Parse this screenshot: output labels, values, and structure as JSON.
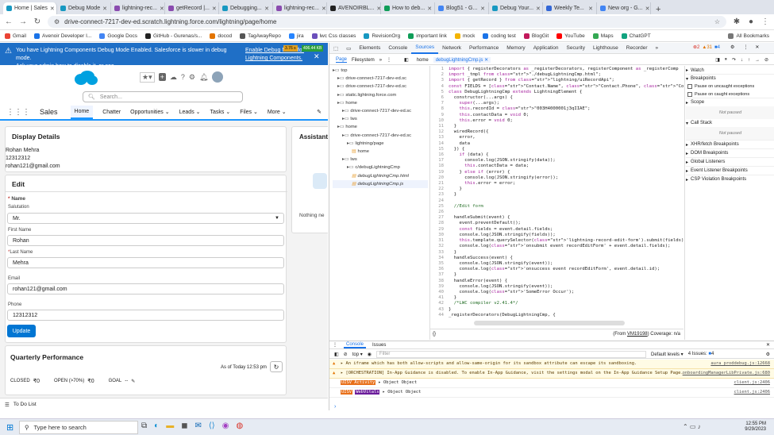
{
  "browser": {
    "tabs": [
      {
        "title": "Home | Sales",
        "active": true,
        "color": "#1798c1"
      },
      {
        "title": "Debug Mode",
        "active": false,
        "color": "#1798c1"
      },
      {
        "title": "lightning-rec...",
        "active": false,
        "color": "#8a4baf"
      },
      {
        "title": "getRecord |...",
        "active": false,
        "color": "#8a4baf"
      },
      {
        "title": "Debugging...",
        "active": false,
        "color": "#1798c1"
      },
      {
        "title": "lightning-rec...",
        "active": false,
        "color": "#8a4baf"
      },
      {
        "title": "AVENOIRBL...",
        "active": false,
        "color": "#222222"
      },
      {
        "title": "How to deb...",
        "active": false,
        "color": "#0f9d58"
      },
      {
        "title": "Blog51 - G...",
        "active": false,
        "color": "#4285f4"
      },
      {
        "title": "Debug Your...",
        "active": false,
        "color": "#1798c1"
      },
      {
        "title": "Weekly Te...",
        "active": false,
        "color": "#3367d6"
      },
      {
        "title": "New org - G...",
        "active": false,
        "color": "#4285f4"
      }
    ],
    "url": "drive-connect-7217-dev-ed.scratch.lightning.force.com/lightning/page/home",
    "bookmarks": [
      "Gmail",
      "Avenoir Developer I...",
      "Google Docs",
      "GitHub - Gurenas/s...",
      "docod",
      "TagAwayRepo",
      "jira",
      "lwc Css classes",
      "RevisionOrg",
      "important link",
      "mock",
      "coding test",
      "BlogGit",
      "YouTube",
      "Maps",
      "ChatGPT"
    ],
    "all_bookmarks": "All Bookmarks"
  },
  "sf": {
    "banner_text_1": "You have Lightning Components Debug Mode Enabled. Salesforce is slower in debug mode.",
    "banner_text_2": "Ask your admin how to disable it, or see",
    "banner_link_1": "Enable Debug Mode for",
    "banner_link_2": "Lightning Components.",
    "debug_badge": "3.76 s",
    "debug_badge2": "406.44 KB",
    "search_placeholder": "Search...",
    "app_name": "Sales",
    "nav": [
      "Home",
      "Chatter",
      "Opportunities",
      "Leads",
      "Tasks",
      "Files",
      "More"
    ],
    "display": {
      "title": "Display Details",
      "name": "Rohan Mehra",
      "phone": "12312312",
      "email": "rohan121@gmail.com"
    },
    "edit": {
      "title": "Edit",
      "name_label": "Name",
      "salutation_label": "Salutation",
      "salutation_value": "Mr.",
      "first_label": "First Name",
      "first_value": "Rohan",
      "last_label": "Last Name",
      "last_value": "Mehra",
      "email_label": "Email",
      "email_value": "rohan121@gmail.com",
      "phone_label": "Phone",
      "phone_value": "12312312",
      "update": "Update"
    },
    "assistant": {
      "title": "Assistant",
      "empty": "Nothing ne"
    },
    "qp": {
      "title": "Quarterly Performance",
      "asof": "As of Today 12:53 pm",
      "closed": "CLOSED",
      "closed_val": "₹0",
      "open": "OPEN (>70%)",
      "open_val": "₹0",
      "goal": "GOAL",
      "goal_val": "--"
    },
    "todo": "To Do List"
  },
  "devtools": {
    "tabs": [
      "Elements",
      "Console",
      "Sources",
      "Network",
      "Performance",
      "Memory",
      "Application",
      "Security",
      "Lighthouse",
      "Recorder"
    ],
    "errors": "2",
    "warnings": "31",
    "infos": "4",
    "sub_tabs": [
      "Page",
      "Filesystem"
    ],
    "file_tabs": [
      "home",
      "debugLightningCmp.js"
    ],
    "tree": [
      {
        "label": "top",
        "depth": 0
      },
      {
        "label": "drive-connect-7217-dev-ed.sc",
        "depth": 1
      },
      {
        "label": "drive-connect-7217-dev-ed.sc",
        "depth": 1
      },
      {
        "label": "static.lightning.force.com",
        "depth": 1
      },
      {
        "label": "home",
        "depth": 1
      },
      {
        "label": "drive-connect-7217-dev-ed.sc",
        "depth": 2
      },
      {
        "label": "lws",
        "depth": 2
      },
      {
        "label": "home",
        "depth": 1
      },
      {
        "label": "drive-connect-7217-dev-ed.sc",
        "depth": 2
      },
      {
        "label": "lightning/page",
        "depth": 3
      },
      {
        "label": "home",
        "depth": 4
      },
      {
        "label": "lws",
        "depth": 2
      },
      {
        "label": "c/debugLightningCmp",
        "depth": 3
      },
      {
        "label": "debugLightningCmp.html",
        "depth": 4
      },
      {
        "label": "debugLightningCmp.js",
        "depth": 4
      }
    ],
    "code": [
      "import { registerDecorators as _registerDecorators, registerComponent as _registerComp",
      "import _tmpl from \"./debugLightningCmp.html\";",
      "import { getRecord } from \"lightning/uiRecordApi\";",
      "const FIELDS = [\"Contact.Name\", \"Contact.Phone\", \"Contact.Email\"];",
      "class DebugLightningCmp extends LightningElement {",
      "  constructor(...args) {",
      "    super(...args);",
      "    this.recordId = \"003H4000001j3qIIAE\";",
      "    this.contactData = void 0;",
      "    this.error = void 0;",
      "  }",
      "  wiredRecord({",
      "    error,",
      "    data",
      "  }) {",
      "    if (data) {",
      "      console.log(JSON.stringify(data));",
      "      this.contactData = data;",
      "    } else if (error) {",
      "      console.log(JSON.stringify(error));",
      "      this.error = error;",
      "    }",
      "  }",
      "",
      "  //Edit form",
      "",
      "  handleSubmit(event) {",
      "    event.preventDefault();",
      "    const fields = event.detail.fields;",
      "    console.log(JSON.stringify(fields));",
      "    this.template.querySelector('lightning-record-edit-form').submit(fields);",
      "    console.log('onsubmit event recordEditForm' + event.detail.fields);",
      "  }",
      "  handleSuccess(event) {",
      "    console.log(JSON.stringify(event));",
      "    console.log('onsuccess event recordEditForm', event.detail.id);",
      "  }",
      "  handleError(event) {",
      "    console.log(JSON.stringify(event));",
      "    console.log('SomeError Occur');",
      "  }",
      "  /*LWC compiler v2.41.4*/",
      "}",
      "_registerDecorators(DebugLightningCmp, {"
    ],
    "status_from": "(From",
    "status_vm": "VM19198",
    "status_cov": ") Coverage: n/a",
    "right_sections": [
      {
        "label": "Watch",
        "open": false
      },
      {
        "label": "Breakpoints",
        "open": true
      }
    ],
    "pause_uncaught": "Pause on uncaught exceptions",
    "pause_caught": "Pause on caught exceptions",
    "scope": "Scope",
    "not_paused": "Not paused",
    "call_stack": "Call Stack",
    "not_paused2": "Not paused",
    "bp_sections": [
      "XHR/fetch Breakpoints",
      "DOM Breakpoints",
      "Global Listeners",
      "Event Listener Breakpoints",
      "CSP Violation Breakpoints"
    ],
    "console_tabs": [
      "Console",
      "Issues"
    ],
    "console_context": "top",
    "filter_placeholder": "Filter",
    "levels": "Default levels",
    "issues": "4 Issues:",
    "issues_count": "4",
    "console_lines": [
      {
        "type": "warn",
        "text": "An iframe which has both allow-scripts and allow-same-origin for its sandbox attribute can escape its sandboxing.",
        "src": "aura_proddebug.js:12668"
      },
      {
        "type": "warn",
        "text": "[ORCHESTRATION] In-App Guidance is disabled. To enable In-App Guidance, visit the settings modal on the In-App Guidance Setup Page.",
        "src": "onboardingManagerLibPrivate.js:680"
      },
      {
        "type": "info",
        "tag": "UISV Activity",
        "text": "Object Object",
        "src": "client.js:2406"
      },
      {
        "type": "info",
        "tag": "UISV",
        "tag2": "WebVitals",
        "text": "Object Object",
        "src": "client.js:2406"
      }
    ]
  },
  "taskbar": {
    "search": "Type here to search",
    "time": "12:55 PM",
    "date": "9/29/2023"
  }
}
